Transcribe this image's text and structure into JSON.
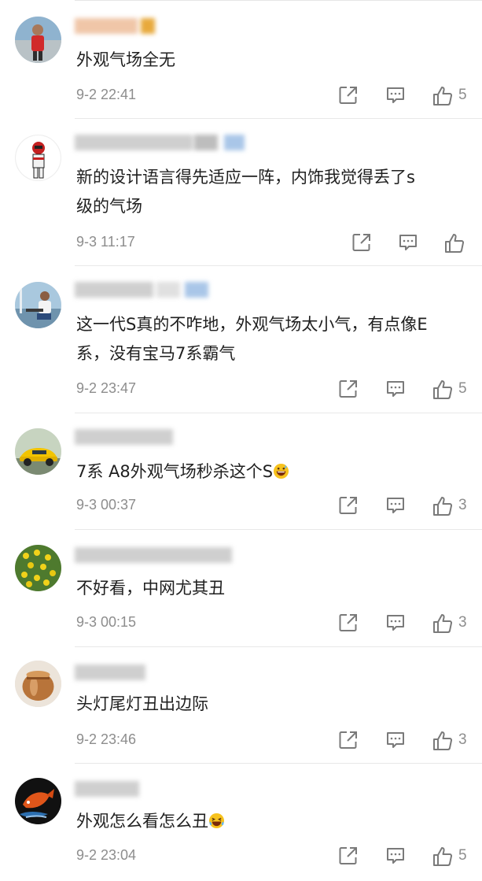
{
  "colors": {
    "meta": "#8d8d8d",
    "text": "#1f1f1f",
    "divider": "#e8e8e8",
    "icon": "#7a7a7a"
  },
  "comments": [
    {
      "text": "外观气场全无",
      "time": "9-2 22:41",
      "likes": "5",
      "avatar": "man-red-shirt"
    },
    {
      "text": "新的设计语言得先适应一阵，内饰我觉得丢了s\n级的气场",
      "time": "9-3 11:17",
      "likes": "",
      "avatar": "racing-driver"
    },
    {
      "text": "这一代S真的不咋地，外观气场太小气，有点像E\n系，没有宝马7系霸气",
      "time": "9-2 23:47",
      "likes": "5",
      "avatar": "man-on-boat"
    },
    {
      "text": "7系 A8外观气场秒杀这个S",
      "time": "9-3 00:37",
      "likes": "3",
      "avatar": "yellow-sports-car",
      "emoji": "grinning-sweat-emoji"
    },
    {
      "text": "不好看，中网尤其丑",
      "time": "9-3 00:15",
      "likes": "3",
      "avatar": "yellow-flowers"
    },
    {
      "text": "头灯尾灯丑出边际",
      "time": "9-2 23:46",
      "likes": "3",
      "avatar": "copper-pot"
    },
    {
      "text": "外观怎么看怎么丑",
      "time": "9-2 23:04",
      "likes": "5",
      "avatar": "koi-fish",
      "emoji": "crying-laughing-emoji"
    }
  ],
  "icons": {
    "share": "share-icon",
    "reply": "reply-icon",
    "like": "thumbs-up-icon"
  }
}
